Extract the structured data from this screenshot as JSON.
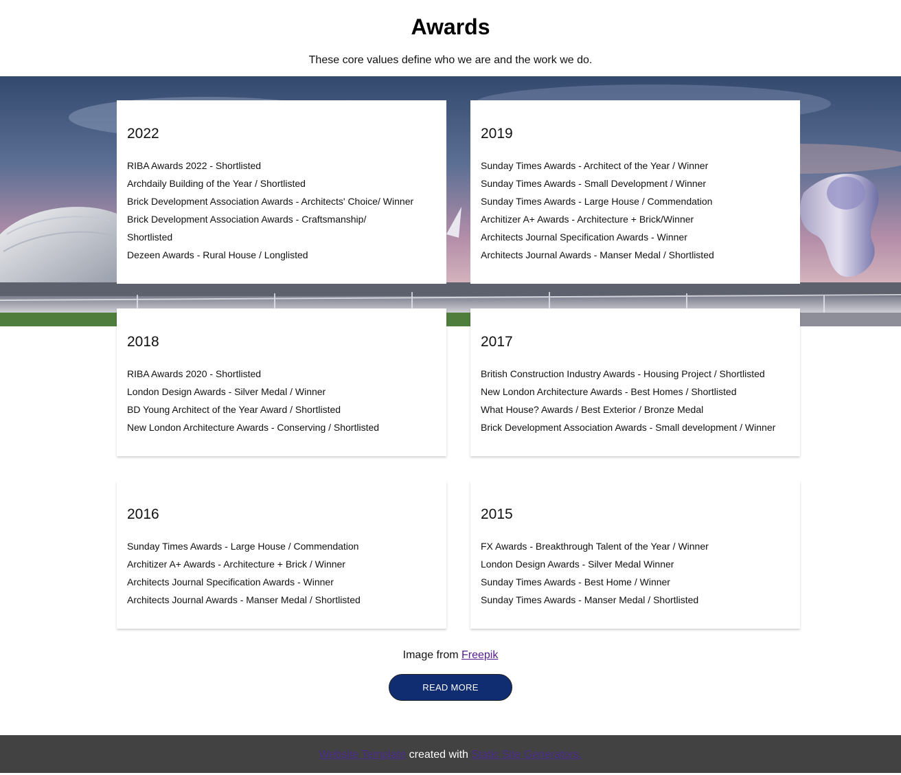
{
  "header": {
    "title": "Awards",
    "subtitle": "These core values define who we are and the work we do."
  },
  "awards": [
    {
      "year": "2022",
      "items": [
        "RIBA Awards 2022 - Shortlisted",
        "Archdaily Building of the Year / Shortlisted",
        "Brick Development Association Awards - Architects' Choice/ Winner",
        "Brick Development Association Awards - Craftsmanship/",
        "Shortlisted",
        "Dezeen Awards - Rural House / Longlisted"
      ]
    },
    {
      "year": "2019",
      "items": [
        "Sunday Times Awards - Architect of the Year / Winner",
        "Sunday Times Awards - Small Development / Winner",
        "Sunday Times Awards - Large House / Commendation",
        "Architizer A+ Awards - Architecture + Brick/Winner",
        "Architects Journal Specification Awards - Winner",
        "Architects Journal Awards - Manser Medal / Shortlisted"
      ]
    },
    {
      "year": "2018",
      "items": [
        "RIBA Awards 2020 - Shortlisted",
        "London Design Awards - Silver Medal / Winner",
        "BD Young Architect of the Year Award / Shortlisted",
        "New London Architecture Awards - Conserving / Shortlisted"
      ]
    },
    {
      "year": "2017",
      "items": [
        "British Construction Industry Awards - Housing Project / Shortlisted",
        "New London Architecture Awards - Best Homes / Shortlisted",
        "What House? Awards / Best Exterior / Bronze Medal",
        "Brick Development Association Awards - Small development / Winner"
      ]
    },
    {
      "year": "2016",
      "items": [
        "Sunday Times Awards - Large House / Commendation",
        "Architizer A+ Awards - Architecture + Brick / Winner",
        "Architects Journal Specification Awards - Winner",
        "Architects Journal Awards - Manser Medal / Shortlisted"
      ]
    },
    {
      "year": "2015",
      "items": [
        "FX Awards - Breakthrough Talent of the Year / Winner",
        "London Design Awards - Silver Medal Winner",
        "Sunday Times Awards - Best Home / Winner",
        "Sunday Times Awards - Manser Medal / Shortlisted"
      ]
    }
  ],
  "credit": {
    "prefix": "Image from ",
    "link_text": "Freepik"
  },
  "cta": {
    "label": "READ MORE"
  },
  "footer": {
    "link1": "Website Template",
    "middle": " created with ",
    "link2": "Static Site Generators."
  },
  "colors": {
    "button_bg": "#0f2d70",
    "footer_bg": "#424242",
    "link_visited": "#551a8b"
  }
}
